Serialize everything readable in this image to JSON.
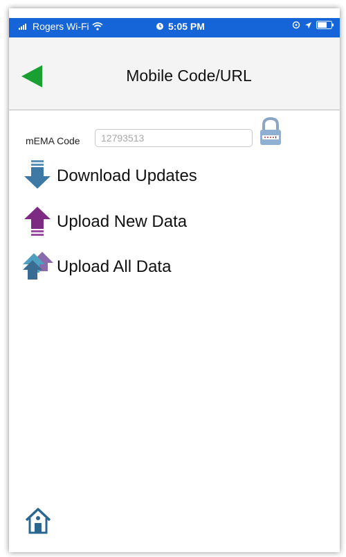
{
  "status_bar": {
    "carrier": "Rogers Wi-Fi",
    "time": "5:05 PM",
    "wifi_icon": "wifi-icon",
    "alarm_icon": "alarm-clock-icon",
    "battery_icon": "battery-icon"
  },
  "nav": {
    "title": "Mobile Code/URL",
    "back_icon": "back-arrow-icon",
    "back_color": "#1aa032"
  },
  "code": {
    "label": "mEMA Code",
    "value": "12793513",
    "lock_icon": "lock-icon"
  },
  "actions": [
    {
      "label": "Download Updates",
      "icon": "download-arrow-icon",
      "color": "#3e79a6"
    },
    {
      "label": "Upload New Data",
      "icon": "upload-arrow-icon",
      "color": "#7d2a83"
    },
    {
      "label": "Upload All Data",
      "icon": "upload-all-arrows-icon",
      "color": "#4a88b0"
    }
  ],
  "footer": {
    "home_icon": "home-icon",
    "home_color": "#2a6790"
  },
  "colors": {
    "status_bar_bg": "#1565d8",
    "nav_bg": "#f4f4f5"
  }
}
